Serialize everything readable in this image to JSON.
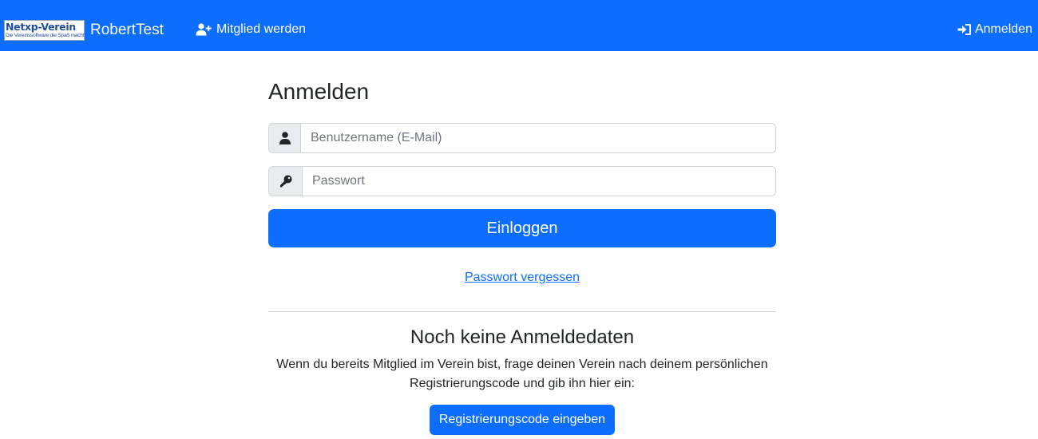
{
  "navbar": {
    "logo_title": "Netxp-Verein",
    "logo_tagline": "Die Vereinssoftware die Spaß macht!",
    "brand": "RobertTest",
    "join_label": "Mitglied werden",
    "join_icon": "user-plus-icon",
    "login_label": "Anmelden",
    "login_icon": "sign-in-icon",
    "background_color": "#0d6efd"
  },
  "login": {
    "title": "Anmelden",
    "username_placeholder": "Benutzername (E-Mail)",
    "username_value": "",
    "username_icon": "user-icon",
    "password_placeholder": "Passwort",
    "password_value": "",
    "password_icon": "key-icon",
    "submit_label": "Einloggen",
    "forgot_label": "Passwort vergessen"
  },
  "register": {
    "title": "Noch keine Anmeldedaten",
    "info": "Wenn du bereits Mitglied im Verein bist, frage deinen Verein nach deinem persönlichen Registrierungscode und gib ihn hier ein:",
    "button_label": "Registrierungscode eingeben"
  },
  "colors": {
    "primary": "#0d6efd",
    "text": "#212529",
    "addon_background": "#e9ecef"
  }
}
